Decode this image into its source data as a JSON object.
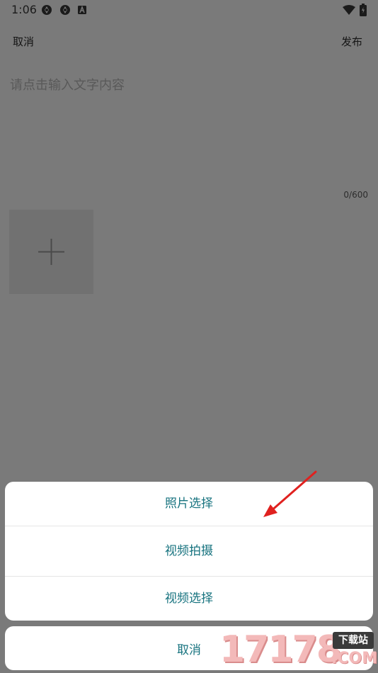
{
  "status_bar": {
    "time": "1:06",
    "icons": [
      "aperture-icon",
      "aperture-icon",
      "a-box-icon",
      "wifi-icon",
      "battery-icon"
    ]
  },
  "header": {
    "cancel_label": "取消",
    "publish_label": "发布"
  },
  "editor": {
    "placeholder": "请点击输入文字内容",
    "char_count": "0/600"
  },
  "media": {
    "add_icon": "plus-icon"
  },
  "action_sheet": {
    "items": [
      {
        "label": "照片选择"
      },
      {
        "label": "视频拍摄"
      },
      {
        "label": "视频选择"
      }
    ],
    "cancel_label": "取消"
  },
  "colors": {
    "overlay": "#7a7a7a",
    "action_text": "#17737f",
    "arrow": "#e0211f"
  },
  "watermark": {
    "number": "17178",
    "badge": "下载站",
    "suffix": ".COM"
  }
}
